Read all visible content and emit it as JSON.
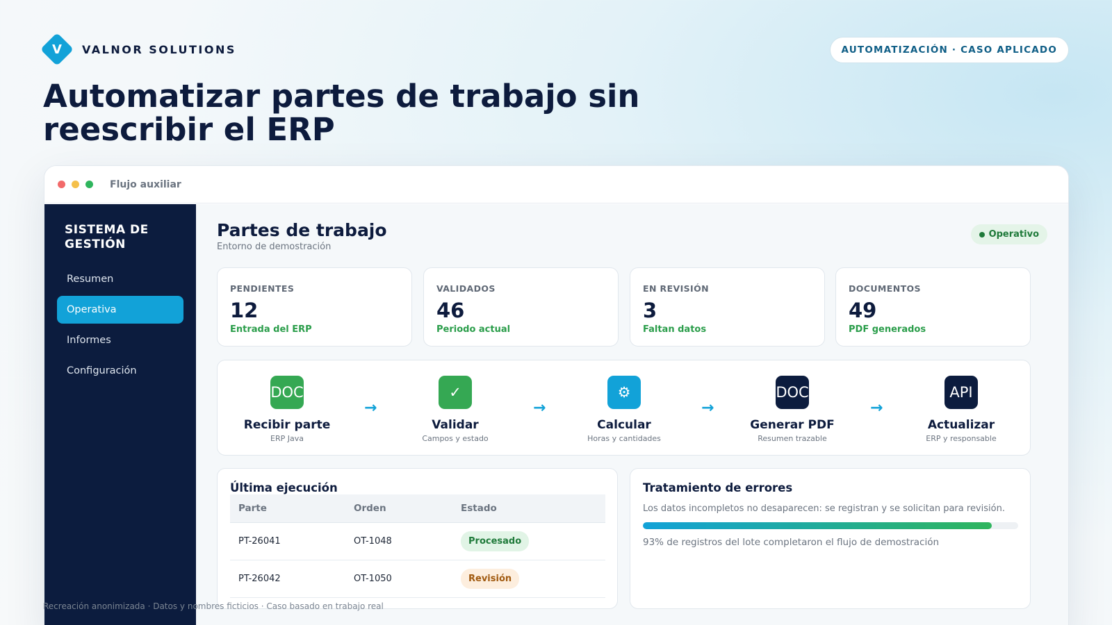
{
  "brand": {
    "logo_letter": "V",
    "name": "VALNOR SOLUTIONS"
  },
  "tag": "AUTOMATIZACIÓN · CASO APLICADO",
  "headline": "Automatizar partes de trabajo sin reescribir el ERP",
  "window": {
    "title": "Flujo auxiliar"
  },
  "sidebar": {
    "title": "SISTEMA DE GESTIÓN",
    "items": [
      {
        "label": "Resumen",
        "active": false
      },
      {
        "label": "Operativa",
        "active": true
      },
      {
        "label": "Informes",
        "active": false
      },
      {
        "label": "Configuración",
        "active": false
      }
    ]
  },
  "main": {
    "title": "Partes de trabajo",
    "subtitle": "Entorno de demostración",
    "status": "Operativo",
    "kpis": [
      {
        "label": "PENDIENTES",
        "value": "12",
        "note": "Entrada del ERP"
      },
      {
        "label": "VALIDADOS",
        "value": "46",
        "note": "Periodo actual"
      },
      {
        "label": "EN REVISIÓN",
        "value": "3",
        "note": "Faltan datos"
      },
      {
        "label": "DOCUMENTOS",
        "value": "49",
        "note": "PDF generados"
      }
    ],
    "flow": [
      {
        "icon": "DOC",
        "icon_name": "document-icon",
        "color": "#35a853",
        "name": "Recibir parte",
        "desc": "ERP Java"
      },
      {
        "icon": "✓",
        "icon_name": "check-icon",
        "color": "#35a853",
        "name": "Validar",
        "desc": "Campos y estado"
      },
      {
        "icon": "⚙",
        "icon_name": "gear-icon",
        "color": "#12a2d8",
        "name": "Calcular",
        "desc": "Horas y cantidades"
      },
      {
        "icon": "DOC",
        "icon_name": "document-icon",
        "color": "#0c1c3e",
        "name": "Generar PDF",
        "desc": "Resumen trazable"
      },
      {
        "icon": "API",
        "icon_name": "api-icon",
        "color": "#0c1c3e",
        "name": "Actualizar",
        "desc": "ERP y responsable"
      }
    ],
    "flow_arrow": "→",
    "last_run": {
      "title": "Última ejecución",
      "columns": [
        "Parte",
        "Orden",
        "Estado"
      ],
      "rows": [
        {
          "parte": "PT-26041",
          "orden": "OT-1048",
          "estado": "Procesado",
          "kind": "ok"
        },
        {
          "parte": "PT-26042",
          "orden": "OT-1050",
          "estado": "Revisión",
          "kind": "rev"
        }
      ]
    },
    "errors": {
      "title": "Tratamiento de errores",
      "description": "Los datos incompletos no desaparecen: se registran y se solicitan para revisión.",
      "progress_percent": 93,
      "note": "93% de registros del lote completaron el flujo de demostración"
    }
  },
  "footer": "Recreación anonimizada · Datos y nombres ficticios · Caso basado en trabajo real",
  "colors": {
    "accent": "#12a2d8",
    "navy": "#0c1c3e",
    "green": "#2fb55d"
  }
}
